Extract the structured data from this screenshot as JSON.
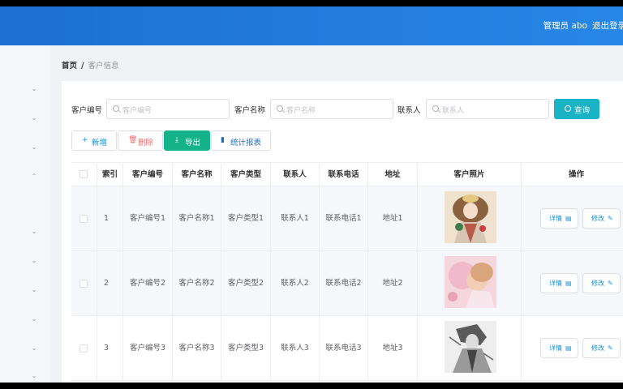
{
  "header": {
    "user": "管理员 abo",
    "logout": "退出登录"
  },
  "breadcrumb": {
    "home": "首页",
    "separator": "/",
    "current": "客户信息"
  },
  "search": {
    "fields": [
      {
        "label": "客户编号",
        "placeholder": "客户编号"
      },
      {
        "label": "客户名称",
        "placeholder": "客户名称"
      },
      {
        "label": "联系人",
        "placeholder": "联系人"
      }
    ],
    "query_label": "查询"
  },
  "toolbar": {
    "add_label": "新增",
    "delete_label": "删除",
    "export_label": "导出",
    "stats_label": "统计报表"
  },
  "table": {
    "columns": [
      "索引",
      "客户编号",
      "客户名称",
      "客户类型",
      "联系人",
      "联系电话",
      "地址",
      "客户照片",
      "操作"
    ],
    "rows": [
      {
        "index": "1",
        "code": "客户编号1",
        "name": "客户名称1",
        "type": "客户类型1",
        "contact": "联系人1",
        "phone": "联系电话1",
        "address": "地址1"
      },
      {
        "index": "2",
        "code": "客户编号2",
        "name": "客户名称2",
        "type": "客户类型2",
        "contact": "联系人2",
        "phone": "联系电话2",
        "address": "地址2"
      },
      {
        "index": "3",
        "code": "客户编号3",
        "name": "客户名称3",
        "type": "客户类型3",
        "contact": "联系人3",
        "phone": "联系电话3",
        "address": "地址3"
      }
    ],
    "detail_label": "详情",
    "edit_label": "修改"
  },
  "colors": {
    "header": "#1d6fd1",
    "query": "#1ab2c5",
    "export": "#14b38a",
    "delete": "#f56c6c"
  }
}
